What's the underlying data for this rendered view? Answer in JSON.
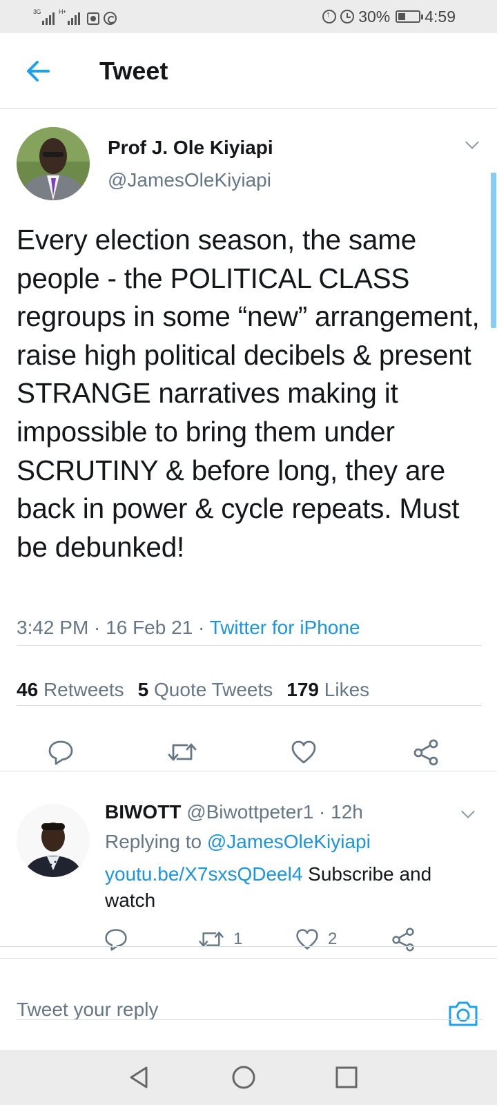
{
  "status_bar": {
    "network1": "3G",
    "network2": "H+",
    "battery_percent": "30%",
    "time": "4:59"
  },
  "header": {
    "title": "Tweet"
  },
  "tweet": {
    "author_name": "Prof J. Ole Kiyiapi",
    "author_handle": "@JamesOleKiyiapi",
    "text": "Every election season, the same people - the POLITICAL CLASS regroups in some “new” arrangement, raise high political decibels & present STRANGE narratives making it  impossible to bring them under SCRUTINY & before long, they are back in power & cycle repeats. Must be debunked!",
    "timestamp": "3:42 PM · 16 Feb 21 · ",
    "source": "Twitter for iPhone",
    "stats": {
      "retweets_count": "46",
      "retweets_label": "Retweets",
      "quotes_count": "5",
      "quotes_label": "Quote Tweets",
      "likes_count": "179",
      "likes_label": "Likes"
    }
  },
  "reply": {
    "name": "BIWOTT",
    "handle_time": " @Biwottpeter1 · 12h",
    "replying_prefix": "Replying to ",
    "replying_to": "@JamesOleKiyiapi",
    "link": "youtu.be/X7sxsQDeel4",
    "text": "  Subscribe and watch",
    "retweet_count": "1",
    "like_count": "2"
  },
  "compose": {
    "placeholder": "Tweet your reply"
  },
  "colors": {
    "accent": "#1b95e0",
    "secondary_text": "#657786",
    "divider": "#d8dde1"
  },
  "icons": {
    "back": "arrow-left-icon",
    "caret": "chevron-down-icon",
    "reply": "speech-bubble-icon",
    "retweet": "retweet-icon",
    "like": "heart-icon",
    "share": "share-icon",
    "camera": "camera-icon"
  }
}
